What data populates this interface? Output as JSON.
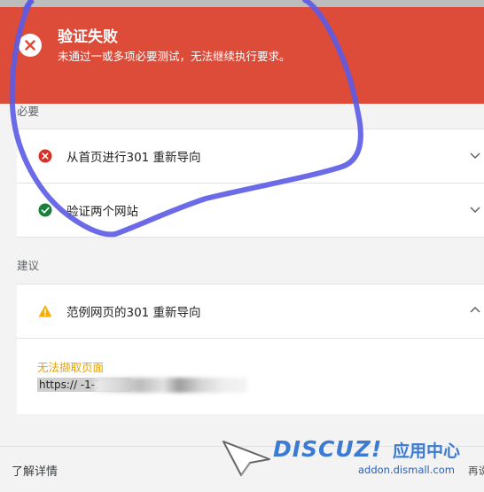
{
  "banner": {
    "title": "验证失败",
    "subtitle": "未通过一或多项必要测试，无法继续执行要求。"
  },
  "required": {
    "label": "必要",
    "items": [
      {
        "label": "从首页进行301 重新导向",
        "status": "error"
      },
      {
        "label": "验证两个网站",
        "status": "success"
      }
    ]
  },
  "suggested": {
    "label": "建议",
    "items": [
      {
        "label": "范例网页的301 重新导向",
        "status": "warning",
        "expanded": true,
        "detail_title": "无法撷取页面",
        "detail_url": "https://                              -1-1.html"
      }
    ]
  },
  "footer": {
    "learn_more": "了解详情"
  },
  "watermark": {
    "brand": "DISCUZ!",
    "brand_cn": "应用中心",
    "site": "addon.dismall.com",
    "tail": "再说"
  },
  "colors": {
    "banner": "#dd4b39",
    "error": "#d93025",
    "success": "#188038",
    "warning": "#f9ab00",
    "annotation": "#5b5be6"
  }
}
